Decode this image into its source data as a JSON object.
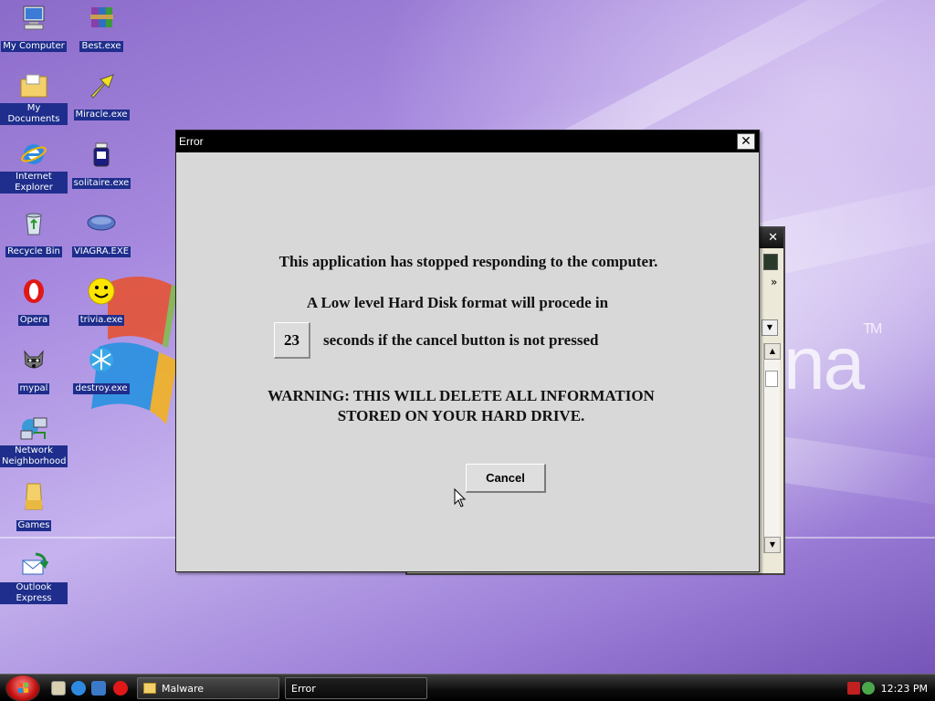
{
  "desktop": {
    "icons": [
      {
        "label": "My Computer",
        "icon": "computer-icon"
      },
      {
        "label": "Best.exe",
        "icon": "winrar-icon"
      },
      {
        "label": "My Documents",
        "icon": "folder-icon"
      },
      {
        "label": "Miracle.exe",
        "icon": "arrow-icon"
      },
      {
        "label": "Internet Explorer",
        "icon": "internet-explorer-icon"
      },
      {
        "label": "solitaire.exe",
        "icon": "jar-icon"
      },
      {
        "label": "Recycle Bin",
        "icon": "recycle-bin-icon"
      },
      {
        "label": "VIAGRA.EXE",
        "icon": "pill-icon"
      },
      {
        "label": "Opera",
        "icon": "opera-icon"
      },
      {
        "label": "trivia.exe",
        "icon": "smiley-icon"
      },
      {
        "label": "mypal",
        "icon": "raccoon-icon"
      },
      {
        "label": "destroy.exe",
        "icon": "snowflake-icon"
      },
      {
        "label": "Network Neighborhood",
        "icon": "network-icon"
      },
      {
        "label": "Games",
        "icon": "folder-icon"
      },
      {
        "label": "Outlook Express",
        "icon": "outlook-express-icon"
      }
    ],
    "wallpaper_text": "na",
    "wallpaper_tm": "TM"
  },
  "dialog": {
    "title": "Error",
    "close_glyph": "✕",
    "line1": "This application has stopped responding to the computer.",
    "line2": "A Low level Hard Disk format will procede in",
    "countdown": "23",
    "line3": "seconds if the cancel button is not pressed",
    "warning1": "WARNING:  THIS WILL DELETE ALL INFORMATION",
    "warning2": "STORED ON YOUR HARD DRIVE.",
    "cancel_label": "Cancel"
  },
  "background_window": {
    "close_glyph": "✕",
    "chevron": "»"
  },
  "taskbar": {
    "buttons": [
      {
        "label": "Malware",
        "icon": "folder-icon"
      },
      {
        "label": "Error",
        "icon": ""
      }
    ],
    "clock": "12:23 PM"
  },
  "colors": {
    "label_bg": "#1f2e8c",
    "titlebar": "#000000",
    "dialog_bg": "#d8d8d8"
  }
}
